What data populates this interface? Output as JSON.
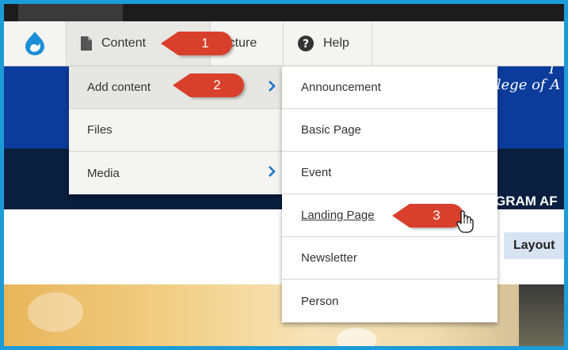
{
  "toolbar": {
    "logo_icon": "drupal-drop-icon",
    "content_label": "Content",
    "content_icon": "document-icon",
    "structure_label": "tructure",
    "help_label": "Help",
    "help_icon": "question-circle-icon"
  },
  "content_menu": {
    "items": [
      {
        "label": "Add content",
        "has_submenu": true
      },
      {
        "label": "Files",
        "has_submenu": false
      },
      {
        "label": "Media",
        "has_submenu": true
      }
    ]
  },
  "add_content_menu": {
    "items": [
      {
        "label": "Announcement"
      },
      {
        "label": "Basic Page"
      },
      {
        "label": "Event"
      },
      {
        "label": "Landing Page"
      },
      {
        "label": "Newsletter"
      },
      {
        "label": "Person"
      }
    ]
  },
  "callouts": {
    "c1": "1",
    "c2": "2",
    "c3": "3"
  },
  "page": {
    "college_text": "llege of A",
    "college_top_char": "I",
    "program_text": "GRAM AF",
    "layout_button": "Layout"
  },
  "colors": {
    "accent_blue": "#1d9bd7",
    "callout_red": "#d9402b",
    "banner_blue": "#0b3c9c",
    "banner_navy": "#0a1e40"
  }
}
